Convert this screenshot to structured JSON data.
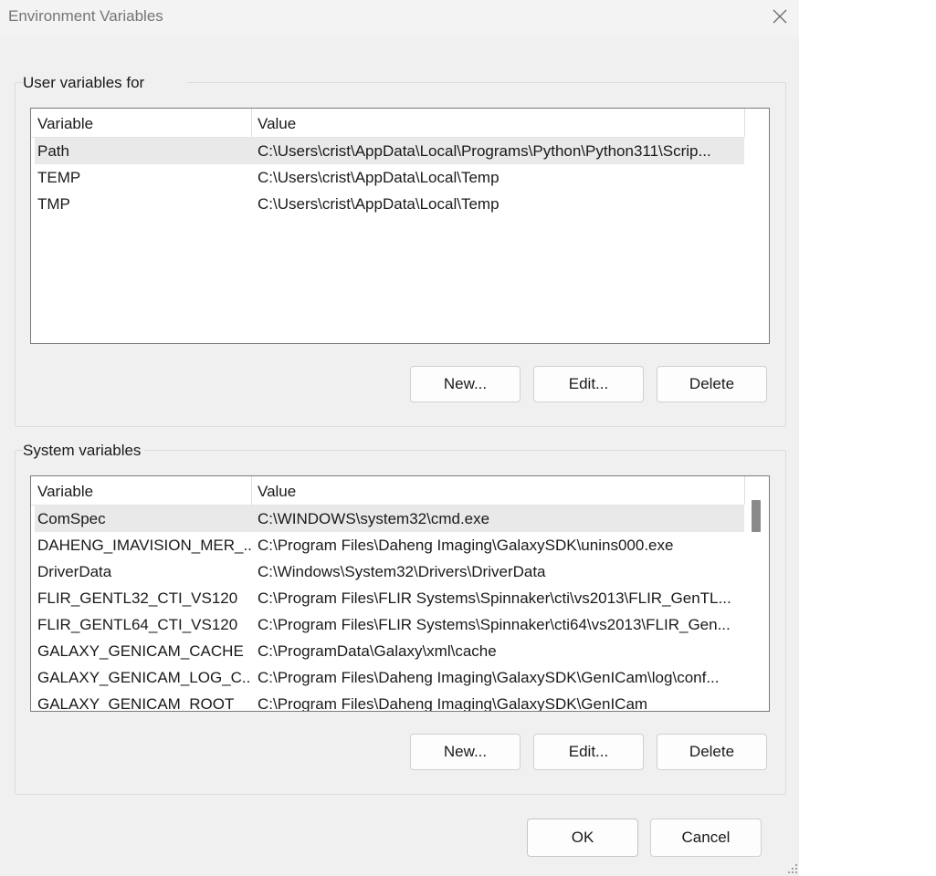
{
  "window": {
    "title": "Environment Variables"
  },
  "user_vars": {
    "label": "User variables for",
    "columns": [
      "Variable",
      "Value"
    ],
    "rows": [
      {
        "variable": "Path",
        "value": "C:\\Users\\crist\\AppData\\Local\\Programs\\Python\\Python311\\Scrip...",
        "selected": true
      },
      {
        "variable": "TEMP",
        "value": "C:\\Users\\crist\\AppData\\Local\\Temp",
        "selected": false
      },
      {
        "variable": "TMP",
        "value": "C:\\Users\\crist\\AppData\\Local\\Temp",
        "selected": false
      }
    ],
    "buttons": {
      "new": "New...",
      "edit": "Edit...",
      "delete": "Delete"
    }
  },
  "system_vars": {
    "label": "System variables",
    "columns": [
      "Variable",
      "Value"
    ],
    "rows": [
      {
        "variable": "ComSpec",
        "value": "C:\\WINDOWS\\system32\\cmd.exe",
        "selected": true
      },
      {
        "variable": "DAHENG_IMAVISION_MER_...",
        "value": "C:\\Program Files\\Daheng Imaging\\GalaxySDK\\unins000.exe",
        "selected": false
      },
      {
        "variable": "DriverData",
        "value": "C:\\Windows\\System32\\Drivers\\DriverData",
        "selected": false
      },
      {
        "variable": "FLIR_GENTL32_CTI_VS120",
        "value": "C:\\Program Files\\FLIR Systems\\Spinnaker\\cti\\vs2013\\FLIR_GenTL...",
        "selected": false
      },
      {
        "variable": "FLIR_GENTL64_CTI_VS120",
        "value": "C:\\Program Files\\FLIR Systems\\Spinnaker\\cti64\\vs2013\\FLIR_Gen...",
        "selected": false
      },
      {
        "variable": "GALAXY_GENICAM_CACHE",
        "value": "C:\\ProgramData\\Galaxy\\xml\\cache",
        "selected": false
      },
      {
        "variable": "GALAXY_GENICAM_LOG_C...",
        "value": "C:\\Program Files\\Daheng Imaging\\GalaxySDK\\GenICam\\log\\conf...",
        "selected": false
      },
      {
        "variable": "GALAXY_GENICAM_ROOT",
        "value": "C:\\Program Files\\Daheng Imaging\\GalaxySDK\\GenICam",
        "selected": false
      }
    ],
    "buttons": {
      "new": "New...",
      "edit": "Edit...",
      "delete": "Delete"
    }
  },
  "footer": {
    "ok": "OK",
    "cancel": "Cancel"
  },
  "icons": {
    "close": "close-icon",
    "resize": "resize-grip-icon"
  },
  "colors": {
    "dialog_bg": "#f0f0f0",
    "selected_row": "#e9e9e9",
    "list_border": "#7a7a7a"
  }
}
